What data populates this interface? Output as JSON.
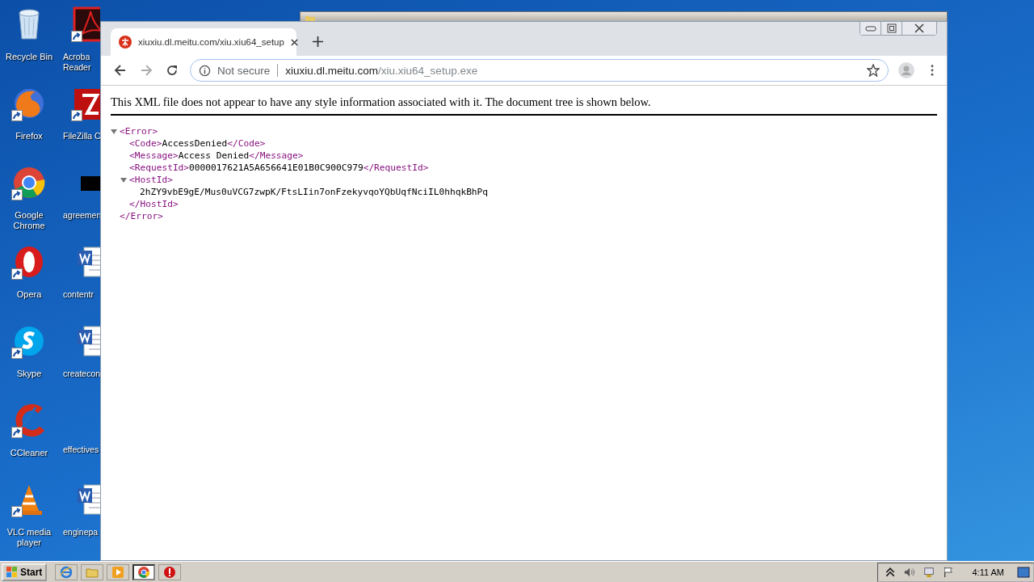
{
  "desktop": {
    "icons": [
      {
        "kind": "bin",
        "lines": [
          "Recycle Bin"
        ],
        "shortcut": false
      },
      {
        "kind": "pdf",
        "lines": [
          "Acroba",
          "Reader"
        ],
        "shortcut": true
      },
      {
        "kind": "fox",
        "lines": [
          "Firefox"
        ],
        "shortcut": true
      },
      {
        "kind": "ftp",
        "lines": [
          "FileZilla C"
        ],
        "shortcut": true
      },
      {
        "kind": "ring",
        "lines": [
          "Google",
          "Chrome"
        ],
        "shortcut": true
      },
      {
        "kind": "image",
        "lines": [
          "agreemen"
        ],
        "shortcut": false
      },
      {
        "kind": "obrowser",
        "lines": [
          "Opera"
        ],
        "shortcut": true
      },
      {
        "kind": "doc",
        "lines": [
          "contentr"
        ],
        "shortcut": false
      },
      {
        "kind": "chat",
        "lines": [
          "Skype"
        ],
        "shortcut": true
      },
      {
        "kind": "doc",
        "lines": [
          "createcon"
        ],
        "shortcut": false
      },
      {
        "kind": "broom",
        "lines": [
          "CCleaner"
        ],
        "shortcut": true
      },
      {
        "kind": "none",
        "lines": [
          "effectives"
        ],
        "shortcut": false
      },
      {
        "kind": "cone",
        "lines": [
          "VLC media",
          "player"
        ],
        "shortcut": true
      },
      {
        "kind": "doc",
        "lines": [
          "enginepa"
        ],
        "shortcut": false
      }
    ]
  },
  "browser": {
    "tab": {
      "title": "xiuxiu.dl.meitu.com/xiu.xiu64_setup",
      "selected": true
    },
    "address": {
      "security": "Not secure",
      "host": "xiuxiu.dl.meitu.com",
      "path": "/xiu.xiu64_setup.exe"
    },
    "notice": "This XML file does not appear to have any style information associated with it. The document tree is shown below.",
    "xml": {
      "open": "<Error>",
      "close": "</Error>",
      "expanded": true,
      "children": [
        {
          "open": "<Code>",
          "text": "AccessDenied",
          "close": "</Code>"
        },
        {
          "open": "<Message>",
          "text": "Access Denied",
          "close": "</Message>"
        },
        {
          "open": "<RequestId>",
          "text": "0000017621A5A656641E01B0C900C979",
          "close": "</RequestId>"
        },
        {
          "open": "<HostId>",
          "text": "2hZY9vbE9gE/Mus0uVCG7zwpK/FtsLIin7onFzekyvqoYQbUqfNciIL0hhqkBhPq",
          "close": "</HostId>",
          "expanded": true
        }
      ]
    }
  },
  "taskbar": {
    "start": "Start",
    "buttons": [
      {
        "kind": "ie",
        "selected": false
      },
      {
        "kind": "folder",
        "selected": false
      },
      {
        "kind": "media",
        "selected": false
      },
      {
        "kind": "ring",
        "selected": true
      },
      {
        "kind": "stop",
        "selected": false
      }
    ],
    "clock": "4:11 AM"
  }
}
